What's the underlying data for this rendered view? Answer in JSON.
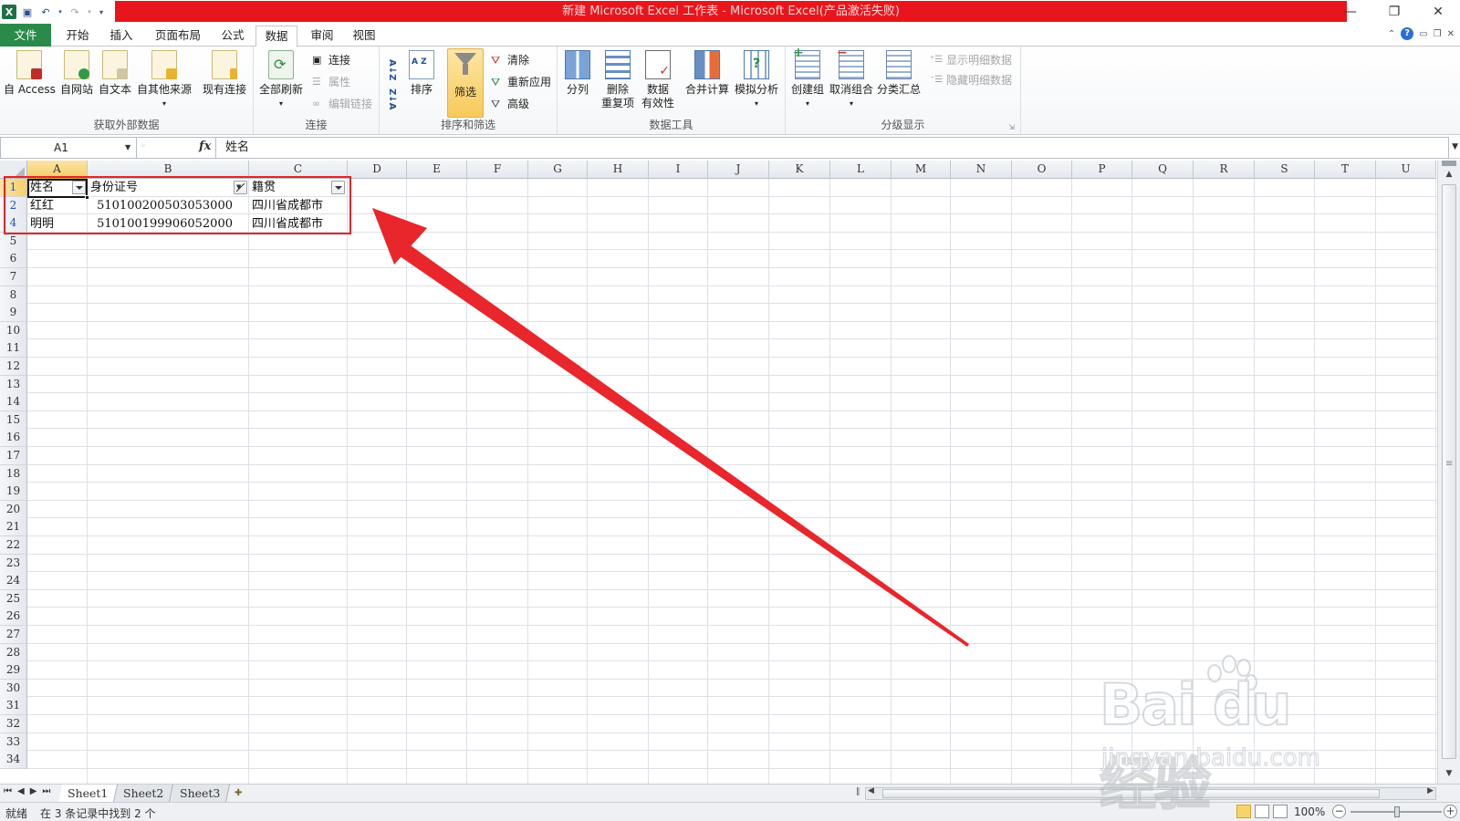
{
  "window": {
    "title": "新建 Microsoft Excel 工作表 - Microsoft Excel(产品激活失败)",
    "icons": [
      "excel-logo-icon",
      "save-icon",
      "undo-icon",
      "redo-icon",
      "customize-qat-icon"
    ]
  },
  "tabs": [
    "文件",
    "开始",
    "插入",
    "页面布局",
    "公式",
    "数据",
    "审阅",
    "视图"
  ],
  "active_tab": "数据",
  "ribbon": {
    "get_external": {
      "label": "获取外部数据",
      "buttons": [
        "自 Access",
        "自网站",
        "自文本",
        "自其他来源",
        "现有连接"
      ]
    },
    "connections": {
      "label": "连接",
      "refresh_all": "全部刷新",
      "connections": "连接",
      "properties": "属性",
      "edit_links": "编辑链接"
    },
    "sort_filter": {
      "label": "排序和筛选",
      "sort": "排序",
      "filter": "筛选",
      "clear": "清除",
      "reapply": "重新应用",
      "advanced": "高级",
      "sort_asc": "A↓Z",
      "sort_desc": "Z↓A"
    },
    "data_tools": {
      "label": "数据工具",
      "text_to_columns": "分列",
      "remove_dup_1": "删除",
      "remove_dup_2": "重复项",
      "validation_1": "数据",
      "validation_2": "有效性",
      "consolidate": "合并计算",
      "what_if": "模拟分析"
    },
    "outline": {
      "label": "分级显示",
      "group": "创建组",
      "ungroup": "取消组合",
      "subtotal": "分类汇总",
      "show_detail": "显示明细数据",
      "hide_detail": "隐藏明细数据"
    }
  },
  "formula_bar": {
    "name_box": "A1",
    "fx": "fx",
    "content": "姓名"
  },
  "columns": [
    "A",
    "B",
    "C",
    "D",
    "E",
    "F",
    "G",
    "H",
    "I",
    "J",
    "K",
    "L",
    "M",
    "N",
    "O",
    "P",
    "Q",
    "R",
    "S",
    "T",
    "U"
  ],
  "row_numbers": [
    "1",
    "2",
    "4",
    "5",
    "6",
    "7",
    "8",
    "9",
    "10",
    "11",
    "12",
    "13",
    "14",
    "15",
    "16",
    "17",
    "18",
    "19",
    "20",
    "21",
    "22",
    "23",
    "24",
    "25",
    "26",
    "27",
    "28",
    "29",
    "30",
    "31",
    "32",
    "33",
    "34"
  ],
  "table": {
    "headers": [
      "姓名",
      "身份证号",
      "籍贯"
    ],
    "rows": [
      [
        "红红",
        "510100200503053000",
        "四川省成都市"
      ],
      [
        "明明",
        "510100199906052000",
        "四川省成都市"
      ]
    ]
  },
  "sheets": [
    "Sheet1",
    "Sheet2",
    "Sheet3"
  ],
  "active_sheet": "Sheet1",
  "status": {
    "ready": "就绪",
    "message": "在 3 条记录中找到 2 个",
    "zoom": "100%"
  },
  "watermark": {
    "brand": "Bai du 经验",
    "url": "jingyan.baidu.com"
  },
  "colors": {
    "title_bar_red": "#e8161c",
    "file_tab_green": "#2a8a4a",
    "highlight_box_red": "#e0262b",
    "arrow_red": "#e8262b",
    "selected_header": "#f6cf6b",
    "filtered_row_number": "#1f4fc8"
  }
}
